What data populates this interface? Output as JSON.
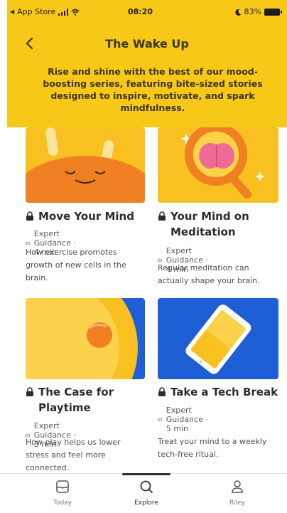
{
  "status_bar": {
    "carrier": "App Store",
    "time": "08:20",
    "battery": "83%"
  },
  "header": {
    "title": "The Wake Up",
    "subtitle": "Rise and shine with the best of our mood-boosting series, featuring bite-sized stories designed to inspire, motivate, and spark mindfulness.",
    "background": "#f8c819"
  },
  "cards": [
    {
      "title": "Move Your Mind",
      "meta": "Expert Guidance · 4 min",
      "description": "How exercise promotes growth of new cells in the brain."
    },
    {
      "title": "Your Mind on Meditation",
      "meta": "Expert Guidance · 4 min",
      "description": "Regular meditation can actually shape your brain."
    },
    {
      "title": "The Case for Playtime",
      "meta": "Expert Guidance · 5 min",
      "description": "How play helps us lower stress and feel more connected."
    },
    {
      "title": "Take a Tech Break",
      "meta": "Expert Guidance · 5 min",
      "description": "Treat your mind to a weekly tech-free ritual."
    }
  ],
  "tabs": [
    {
      "label": "Today",
      "icon": "today-icon"
    },
    {
      "label": "Explore",
      "icon": "search-icon",
      "active": true
    },
    {
      "label": "Riley",
      "icon": "profile-icon"
    }
  ]
}
